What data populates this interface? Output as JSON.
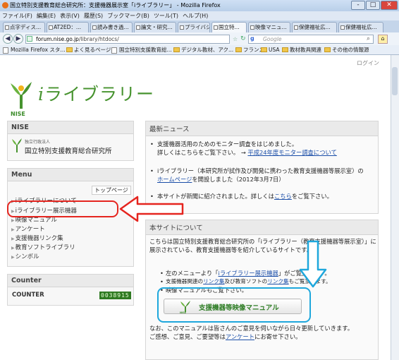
{
  "window": {
    "title": "国立特別支援教育総合研究所：支援機器展示室「iライブラリー」 - Mozilla Firefox",
    "min": "-",
    "max": "□",
    "close": "✕"
  },
  "menubar": [
    "ファイル(F)",
    "編集(E)",
    "表示(V)",
    "履歴(S)",
    "ブックマーク(B)",
    "ツール(T)",
    "ヘルプ(H)"
  ],
  "tabs": [
    "点字ディス...",
    "AT2ED：...",
    "読み書き過...",
    "論文・研究...",
    "プライバシ...",
    "国立特...",
    "映像マニュ...",
    "保健福祉広...",
    "保健福祉広..."
  ],
  "nav": {
    "back": "◀",
    "forward": "▶",
    "url_site": "forum.nise.go.jp",
    "url_path": "/library/htdocs/",
    "search_placeholder": "Google"
  },
  "bookmarks": [
    "Mozilla Firefox スタ...",
    "よく見るページ",
    "国立特別支援教育総...",
    "デジタル教材、アク...",
    "フランス",
    "USA",
    "教材教具関連",
    "その他の情報源"
  ],
  "page": {
    "login": "ログイン",
    "logo_label": "NISE",
    "brand_i": "i",
    "brand_rest": "ライブラリー",
    "nise_box": {
      "header": "NISE",
      "small": "独立行政法人",
      "name": "国立特別支援教育総合研究所"
    },
    "menu_box": {
      "header": "Menu",
      "toppage": "トップページ",
      "items": [
        "iライブラリーについて",
        "iライブラリー展示機器",
        "映像マニュアル",
        "アンケート",
        "支援機器リンク集",
        "教育ソフトライブラリ",
        "シンボル"
      ]
    },
    "counter_box": {
      "header": "Counter",
      "label": "COUNTER",
      "digits": "0038915"
    },
    "news": {
      "header": "最新ニュース",
      "i1_line1": "支援機器活用のためのモニター調査をはじめました。",
      "i1_line2": "詳しくはこちらをご覧下さい。",
      "i1_arrow": "→",
      "i1_link": "平成24年度モニター調査について",
      "i2_line1": "iライブラリー（本研究所が試作及び開発に携わった教育支援機器等展示室）の",
      "i2_link": "ホームページ",
      "i2_rest": "を開設しました（2012年3月7日）",
      "i3_pre": "本サイトが新聞に紹介されました。詳しくは",
      "i3_link": "こちら",
      "i3_post": "をご覧下さい。"
    },
    "about": {
      "header": "本サイトについて",
      "p1_line1": "こちらは国立特別支援教育総合研究所の「iライブラリー（教育支援機器等展示室）」に",
      "p1_line2": "展示されている、教育支援機器等を紹介しているサイトです。",
      "b1_pre": "左のメニューより「",
      "b1_link": "iライブラリー展示機器",
      "b1_post": "」がご覧頂けます。",
      "b2_pre": "支援機器関連の",
      "b2_link1": "リンク集",
      "b2_mid": "及び教育ソフトの",
      "b2_link2": "リンク集",
      "b2_post": "もご覧頂けます。",
      "b3": "映像マニュアルもご覧下さい。",
      "manual_button": "支援機器等映像マニュアル",
      "manual_nise": "NISE",
      "p2_line1": "なお、このマニュアルは皆さんのご意見を伺いながら日々更新していきます。",
      "p2_pre": "ご感想、ご意見、ご要望等は",
      "p2_link": "アンケート",
      "p2_post": "にお寄せ下さい。"
    }
  },
  "colors": {
    "brand_green": "#47932f",
    "link_blue": "#1b4ea8",
    "highlight_red": "#e5251f",
    "highlight_blue": "#1ea7dc"
  }
}
